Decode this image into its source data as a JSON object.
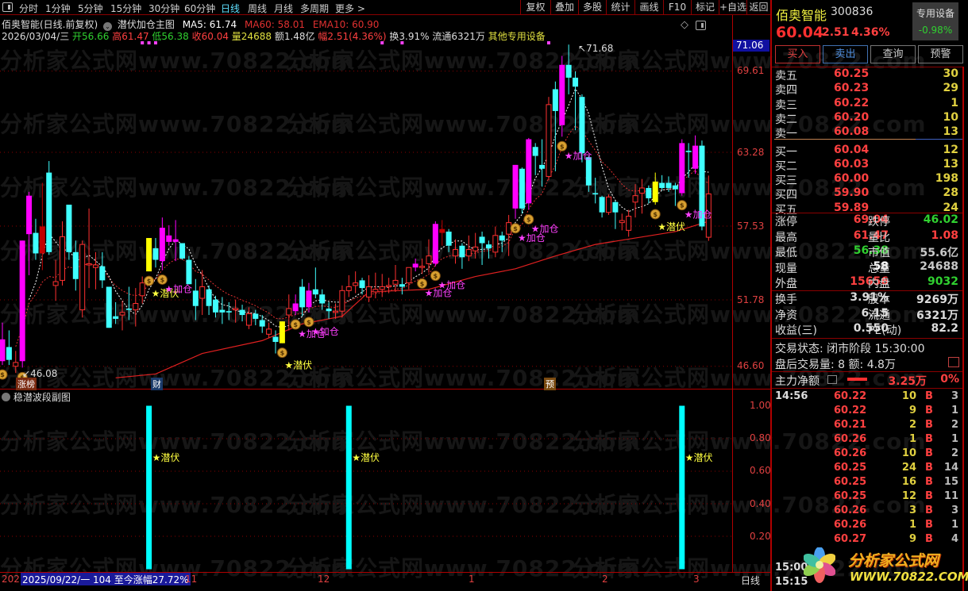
{
  "watermark": "分析家公式网www.70822.com",
  "toolbar": {
    "periods": [
      "分时",
      "1分钟",
      "5分钟",
      "15分钟",
      "30分钟",
      "60分钟",
      "日线",
      "周线",
      "月线",
      "多周期",
      "更多 >"
    ],
    "tools": [
      "复权",
      "叠加",
      "多股",
      "统计",
      "画线",
      "F10",
      "标记",
      "+自选",
      "返回"
    ]
  },
  "chart_header": {
    "title": "佰奥智能(日线.前复权)",
    "indicator": "潜伏加仓主图",
    "ma5": "MA5: 61.74",
    "ma60": "MA60: 58.01",
    "ema10": "EMA10: 60.90"
  },
  "quote_line": {
    "date": "2026/03/04/三",
    "open": "开56.66",
    "high": "高61.47",
    "low": "低56.38",
    "close": "收60.04",
    "vol": "量24688",
    "amount": "额1.48亿",
    "change": "幅2.51(4.36%)",
    "turnover": "换3.91%",
    "float": "流通6321万",
    "sector": "其他专用设备"
  },
  "price_axis": {
    "current": "71.06",
    "labels": [
      "69.61",
      "63.28",
      "57.53",
      "51.78",
      "46.60"
    ]
  },
  "sub_chart": {
    "title": "稳潜波段副图",
    "axis": [
      "1.00",
      "0.80",
      "0.60",
      "0.40",
      "0.20"
    ],
    "label": "★潜伏"
  },
  "time_axis": {
    "start": "202",
    "info": "2025/09/22/一 104 至今涨幅27.72%",
    "months": [
      "11",
      "12",
      "1",
      "2",
      "3"
    ],
    "period": "日线"
  },
  "markers": {
    "zhangbang": "涨榜",
    "cai": "财",
    "yu": "预"
  },
  "chart_data": {
    "type": "candlestick",
    "ylim": [
      45.7,
      71.9
    ],
    "high_label": "71.68",
    "low_label": "46.08",
    "candles": [
      [
        47.0,
        48.7,
        50.0,
        46.7,
        "m"
      ],
      [
        48.1,
        47.1,
        49.4,
        46.7,
        "c"
      ],
      [
        46.6,
        46.9,
        47.8,
        46.08,
        "r"
      ],
      [
        47.0,
        56.4,
        56.4,
        46.5,
        "m"
      ],
      [
        56.9,
        59.9,
        60.2,
        53.7,
        "m"
      ],
      [
        57.0,
        55.4,
        58.1,
        54.9,
        "c"
      ],
      [
        55.4,
        57.5,
        60.9,
        54.1,
        "d"
      ],
      [
        61.7,
        55.5,
        62.6,
        55.3,
        "c"
      ],
      [
        52.9,
        53.2,
        54.9,
        51.7,
        "r"
      ],
      [
        53.3,
        56.7,
        57.9,
        52.9,
        "r"
      ],
      [
        59.2,
        55.5,
        59.2,
        54.9,
        "c"
      ],
      [
        55.5,
        53.4,
        56.4,
        52.5,
        "c"
      ],
      [
        51.0,
        56.1,
        56.4,
        50.4,
        "r"
      ],
      [
        54.5,
        54.6,
        58.9,
        52.7,
        "r"
      ],
      [
        54.3,
        54.5,
        55.5,
        52.6,
        "r"
      ],
      [
        54.4,
        53.3,
        55.5,
        52.7,
        "c"
      ],
      [
        52.8,
        49.6,
        52.8,
        49.6,
        "c"
      ],
      [
        50.5,
        50.3,
        51.6,
        49.9,
        "c"
      ],
      [
        50.6,
        50.8,
        51.7,
        49.4,
        "r"
      ],
      [
        51.1,
        51.0,
        52.8,
        50.2,
        "c"
      ],
      [
        51.0,
        51.5,
        52.7,
        49.7,
        "r"
      ],
      [
        52.1,
        53.1,
        53.6,
        51.5,
        "r"
      ],
      [
        54.0,
        56.6,
        56.6,
        54.0,
        "y"
      ],
      [
        55.8,
        54.9,
        56.6,
        54.3,
        "c"
      ],
      [
        54.8,
        57.4,
        58.2,
        54.1,
        "m"
      ],
      [
        56.3,
        56.8,
        57.6,
        56.0,
        "m"
      ],
      [
        56.3,
        56.5,
        58.0,
        54.8,
        "m"
      ],
      [
        56.2,
        55.0,
        56.2,
        54.9,
        "c"
      ],
      [
        54.9,
        53.0,
        55.2,
        53.0,
        "c"
      ],
      [
        52.5,
        51.3,
        53.4,
        50.2,
        "c"
      ],
      [
        51.9,
        52.8,
        54.1,
        50.6,
        "r"
      ],
      [
        52.6,
        51.3,
        52.9,
        50.6,
        "c"
      ],
      [
        51.8,
        50.8,
        52.1,
        50.4,
        "c"
      ],
      [
        51.0,
        50.8,
        52.0,
        49.9,
        "c"
      ],
      [
        50.9,
        50.8,
        51.6,
        50.2,
        "c"
      ],
      [
        51.0,
        51.1,
        51.8,
        50.0,
        "r"
      ],
      [
        51.0,
        50.6,
        51.4,
        50.1,
        "c"
      ],
      [
        49.8,
        50.7,
        51.2,
        49.5,
        "r"
      ],
      [
        50.7,
        50.3,
        51.0,
        49.8,
        "c"
      ],
      [
        50.2,
        49.7,
        50.6,
        49.2,
        "c"
      ],
      [
        49.1,
        49.5,
        50.0,
        48.8,
        "r"
      ],
      [
        48.9,
        48.5,
        49.4,
        47.6,
        "c"
      ],
      [
        48.4,
        50.1,
        50.1,
        48.4,
        "y"
      ],
      [
        50.6,
        51.1,
        52.2,
        49.4,
        "r"
      ],
      [
        50.9,
        51.5,
        52.2,
        50.6,
        "m"
      ],
      [
        52.8,
        51.2,
        53.4,
        50.5,
        "c"
      ],
      [
        51.2,
        52.5,
        53.1,
        50.8,
        "m"
      ],
      [
        52.6,
        52.2,
        54.3,
        51.9,
        "c"
      ],
      [
        52.2,
        51.5,
        52.6,
        51.0,
        "c"
      ],
      [
        51.1,
        50.9,
        51.6,
        50.3,
        "c"
      ],
      [
        50.8,
        50.9,
        51.5,
        50.3,
        "r"
      ],
      [
        50.9,
        52.5,
        52.9,
        50.4,
        "r"
      ],
      [
        52.5,
        52.8,
        53.7,
        52.0,
        "r"
      ],
      [
        52.9,
        53.1,
        54.0,
        52.3,
        "r"
      ],
      [
        53.3,
        52.7,
        53.5,
        52.2,
        "c"
      ],
      [
        52.0,
        52.8,
        53.7,
        51.6,
        "r"
      ],
      [
        52.4,
        52.6,
        53.9,
        51.9,
        "r"
      ],
      [
        52.6,
        52.8,
        53.8,
        52.0,
        "r"
      ],
      [
        52.8,
        52.9,
        53.5,
        52.3,
        "r"
      ],
      [
        53.0,
        53.3,
        54.5,
        52.4,
        "r"
      ],
      [
        53.0,
        52.8,
        53.5,
        52.2,
        "c"
      ],
      [
        53.1,
        54.3,
        54.3,
        52.6,
        "r"
      ],
      [
        54.3,
        54.6,
        55.0,
        54.0,
        "m"
      ],
      [
        54.3,
        54.4,
        55.0,
        53.8,
        "r"
      ],
      [
        54.6,
        55.2,
        56.5,
        53.9,
        "r"
      ],
      [
        54.6,
        57.7,
        57.9,
        54.4,
        "m"
      ],
      [
        57.0,
        57.3,
        58.0,
        56.0,
        "d"
      ],
      [
        57.1,
        56.0,
        57.3,
        55.5,
        "c"
      ],
      [
        55.2,
        55.7,
        56.5,
        54.6,
        "r"
      ],
      [
        56.0,
        55.1,
        56.2,
        54.2,
        "c"
      ],
      [
        55.2,
        55.7,
        56.8,
        54.8,
        "r"
      ],
      [
        55.6,
        55.9,
        57.0,
        55.0,
        "r"
      ],
      [
        56.7,
        56.2,
        57.1,
        54.5,
        "c"
      ],
      [
        56.1,
        55.8,
        56.4,
        55.0,
        "c"
      ],
      [
        55.5,
        56.8,
        57.5,
        55.1,
        "r"
      ],
      [
        56.8,
        56.4,
        57.1,
        55.5,
        "c"
      ],
      [
        56.9,
        57.8,
        58.4,
        55.2,
        "r"
      ],
      [
        58.9,
        62.3,
        62.3,
        58.1,
        "m"
      ],
      [
        62.0,
        58.9,
        62.1,
        58.5,
        "c"
      ],
      [
        59.3,
        64.3,
        64.4,
        58.8,
        "m"
      ],
      [
        63.7,
        63.0,
        64.0,
        61.5,
        "c"
      ],
      [
        62.3,
        62.0,
        64.3,
        60.6,
        "c"
      ],
      [
        61.4,
        67.0,
        67.6,
        61.1,
        "r"
      ],
      [
        68.2,
        66.5,
        68.8,
        61.8,
        "c"
      ],
      [
        65.4,
        70.1,
        70.8,
        64.5,
        "m"
      ],
      [
        70.1,
        69.1,
        71.68,
        67.8,
        "c"
      ],
      [
        69.1,
        68.4,
        69.6,
        65.0,
        "c"
      ],
      [
        67.6,
        63.2,
        67.8,
        62.5,
        "c"
      ],
      [
        62.9,
        60.7,
        63.0,
        60.2,
        "c"
      ],
      [
        60.1,
        60.0,
        61.3,
        59.3,
        "c"
      ],
      [
        59.8,
        58.6,
        59.9,
        58.2,
        "c"
      ],
      [
        58.6,
        59.8,
        60.0,
        58.4,
        "r"
      ],
      [
        59.4,
        58.6,
        59.5,
        57.3,
        "c"
      ],
      [
        57.8,
        57.96,
        58.5,
        57.2,
        "r"
      ],
      [
        57.2,
        58.3,
        58.8,
        56.7,
        "r"
      ],
      [
        59.4,
        59.9,
        60.8,
        58.2,
        "r"
      ],
      [
        60.1,
        60.5,
        61.2,
        58.5,
        "r"
      ],
      [
        60.5,
        59.7,
        60.7,
        59.3,
        "c"
      ],
      [
        59.4,
        61.0,
        61.7,
        59.2,
        "y"
      ],
      [
        60.9,
        60.5,
        61.5,
        60.3,
        "c"
      ],
      [
        60.9,
        60.5,
        61.4,
        60.2,
        "c"
      ],
      [
        60.7,
        60.4,
        60.9,
        59.1,
        "c"
      ],
      [
        60.1,
        64.0,
        64.3,
        59.9,
        "m"
      ],
      [
        63.4,
        63.3,
        64.0,
        61.3,
        "c"
      ],
      [
        62.0,
        63.8,
        64.6,
        61.6,
        "m"
      ],
      [
        63.8,
        57.5,
        64.2,
        57.2,
        "c"
      ],
      [
        56.66,
        60.04,
        61.47,
        56.38,
        "r"
      ]
    ],
    "ma60": [
      [
        17,
        45.7
      ],
      [
        23,
        46.0
      ],
      [
        30,
        47.6
      ],
      [
        39,
        48.6
      ],
      [
        45,
        49.9
      ],
      [
        51,
        50.5
      ],
      [
        55,
        52.4
      ],
      [
        64,
        52.6
      ],
      [
        71,
        53.6
      ],
      [
        77,
        54.2
      ],
      [
        83,
        55.2
      ],
      [
        89,
        56.1
      ],
      [
        95,
        56.6
      ],
      [
        101,
        57.1
      ],
      [
        106,
        57.9
      ]
    ],
    "bag_signals": [
      0,
      3,
      22,
      24,
      42,
      44,
      46,
      63,
      65,
      77,
      79,
      84,
      98,
      102
    ],
    "qianfu_signals": [
      22,
      42,
      98
    ],
    "jiacang_signals": [
      24,
      44,
      46,
      63,
      65,
      77,
      79,
      84,
      102
    ],
    "top_dots": [
      21,
      22,
      23,
      57,
      60,
      82
    ],
    "sub_bars": [
      {
        "index": 22,
        "value": 1.0
      },
      {
        "index": 52,
        "value": 1.0
      },
      {
        "index": 102,
        "value": 1.0
      }
    ],
    "labels": {
      "qianfu": "★潜伏",
      "jiacang": "★加仓"
    }
  },
  "quote": {
    "name": "佰奥智能",
    "code": "300836",
    "sector": "专用设备",
    "sector_change": "-0.98%",
    "price": "60.04",
    "change": "2.51",
    "change_pct": "4.36%"
  },
  "actions": [
    "买入",
    "卖出",
    "查询",
    "预警"
  ],
  "asks": [
    {
      "label": "卖五",
      "price": "60.25",
      "vol": "30"
    },
    {
      "label": "卖四",
      "price": "60.23",
      "vol": "29"
    },
    {
      "label": "卖三",
      "price": "60.22",
      "vol": "1"
    },
    {
      "label": "卖二",
      "price": "60.20",
      "vol": "10"
    },
    {
      "label": "卖一",
      "price": "60.08",
      "vol": "13"
    }
  ],
  "bids": [
    {
      "label": "买一",
      "price": "60.04",
      "vol": "12"
    },
    {
      "label": "买二",
      "price": "60.03",
      "vol": "13"
    },
    {
      "label": "买三",
      "price": "60.00",
      "vol": "198"
    },
    {
      "label": "买四",
      "price": "59.90",
      "vol": "28"
    },
    {
      "label": "买五",
      "price": "59.89",
      "vol": "24"
    }
  ],
  "stats": [
    {
      "l1": "涨停",
      "v1": "69.04",
      "c1": "#ff4040",
      "l2": "跌停",
      "v2": "46.02",
      "c2": "#30d030"
    },
    {
      "l1": "最高",
      "v1": "61.47",
      "c1": "#ff4040",
      "l2": "量比",
      "v2": "1.08",
      "c2": "#ff4040"
    },
    {
      "l1": "最低",
      "v1": "56.38",
      "c1": "#30d030",
      "l2": "市值",
      "v2": "55.6亿",
      "c2": "#c8c8c8"
    },
    {
      "l1": "现量",
      "v1": "58",
      "c1": "#ffffff",
      "l2": "总量",
      "v2": "24688",
      "c2": "#c8c8c8"
    },
    {
      "l1": "外盘",
      "v1": "15656",
      "c1": "#ff4040",
      "l2": "内盘",
      "v2": "9032",
      "c2": "#30d030"
    }
  ],
  "stats2": [
    {
      "l1": "换手",
      "v1": "3.91%",
      "l2": "股本",
      "v2": "9269万"
    },
    {
      "l1": "净资",
      "v1": "6.15",
      "l2": "流通",
      "v2": "6321万"
    },
    {
      "l1": "收益(三)",
      "v1": "0.550",
      "l2": "PE(动)",
      "v2": "82.2"
    }
  ],
  "trade_status": {
    "line1": "交易状态: 闭市阶段 15:30:00",
    "line2": "盘后交易量: 8  额: 4.8万"
  },
  "main_flow": {
    "label": "主力净额",
    "value": "3.25万",
    "pct": "0%"
  },
  "ticks": {
    "time": "14:56",
    "rows": [
      [
        "60.22",
        "10",
        "B",
        "3"
      ],
      [
        "60.22",
        "9",
        "B",
        "1"
      ],
      [
        "60.21",
        "2",
        "B",
        "2"
      ],
      [
        "60.26",
        "1",
        "B",
        "1"
      ],
      [
        "60.26",
        "10",
        "B",
        "2"
      ],
      [
        "60.25",
        "24",
        "B",
        "14"
      ],
      [
        "60.25",
        "16",
        "B",
        "15"
      ],
      [
        "60.25",
        "12",
        "B",
        "11"
      ],
      [
        "60.26",
        "3",
        "B",
        "3"
      ],
      [
        "60.26",
        "1",
        "B",
        "1"
      ],
      [
        "60.27",
        "9",
        "B",
        "4"
      ]
    ],
    "time2": "15:00",
    "time3": "15:15"
  },
  "logo": {
    "text": "分析家公式网",
    "url": "WWW.70822.COM"
  }
}
